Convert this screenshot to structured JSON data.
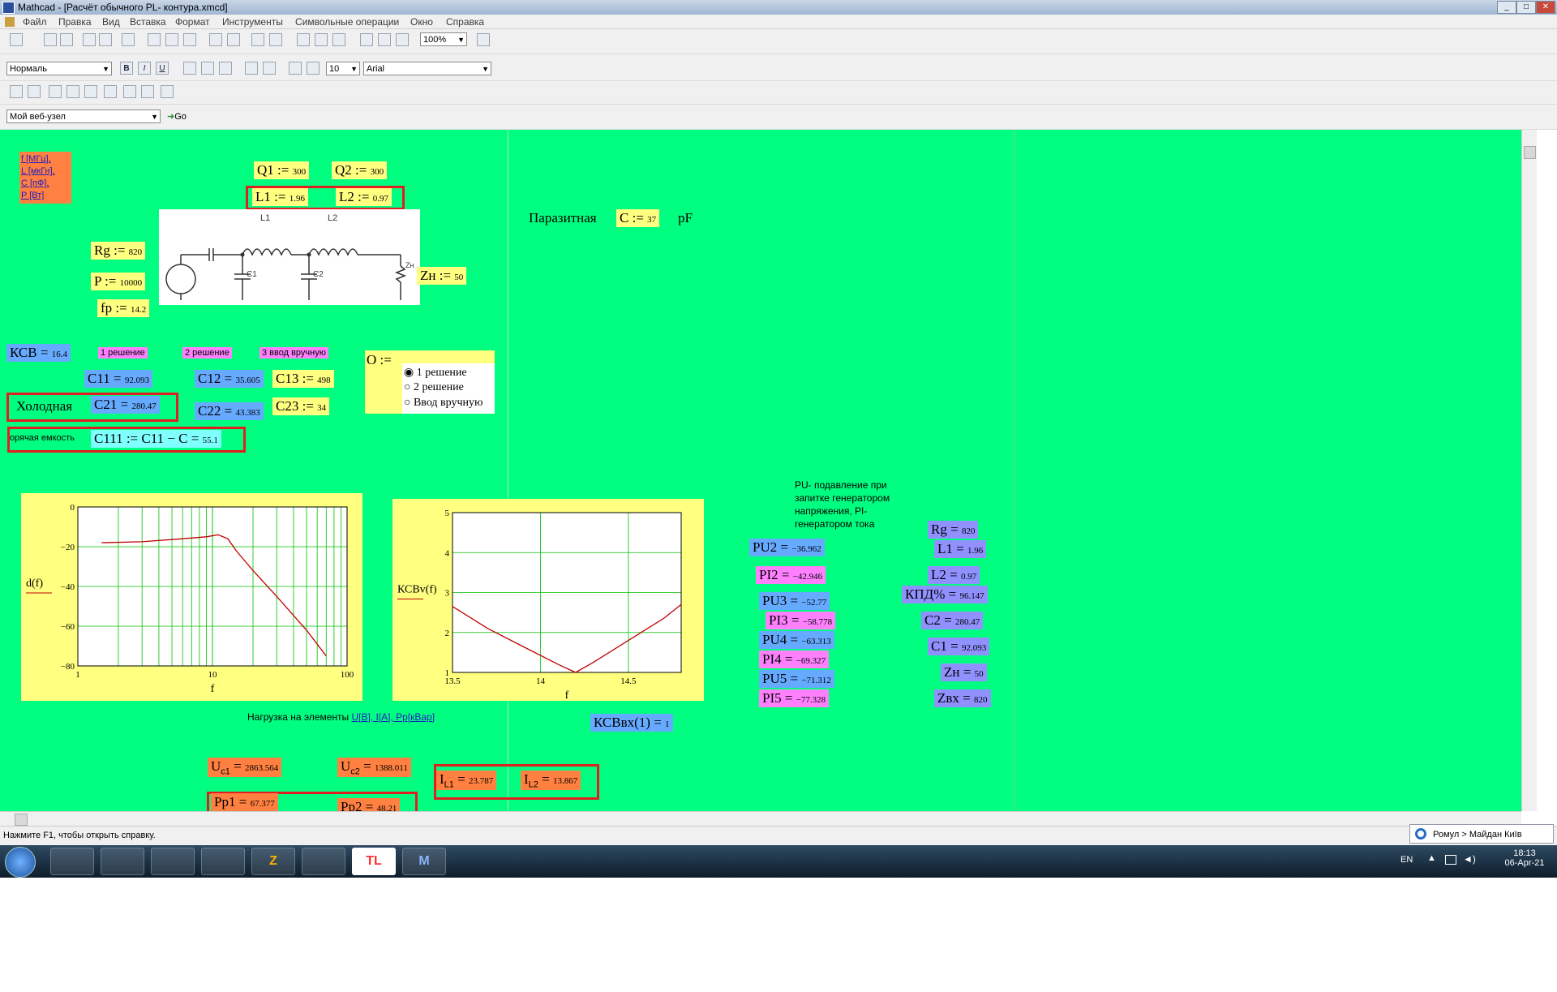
{
  "window": {
    "title": "Mathcad - [Расчёт обычного PL- контура.xmcd]",
    "min": "_",
    "max": "□",
    "close": "✕"
  },
  "menu": [
    "Файл",
    "Правка",
    "Вид",
    "Вставка",
    "Формат",
    "Инструменты",
    "Символьные операции",
    "Окно",
    "Справка"
  ],
  "toolbar": {
    "zoom": "100%",
    "style": "Нормаль",
    "font_size": "10",
    "font": "Arial",
    "bold": "B",
    "italic": "I",
    "underline": "U",
    "web_node": "Мой веб-узел",
    "go": "Go"
  },
  "sheet": {
    "units_note": [
      "f [МГц],",
      "L [мкГн],",
      "C [пФ],",
      "P [Вт]"
    ],
    "Q1": {
      "name": "Q1",
      "op": ":=",
      "val": "300"
    },
    "Q2": {
      "name": "Q2",
      "op": ":=",
      "val": "300"
    },
    "L1": {
      "name": "L1",
      "op": ":=",
      "val": "1.96"
    },
    "L2": {
      "name": "L2",
      "op": ":=",
      "val": "0.97"
    },
    "Rg": {
      "name": "Rg",
      "op": ":=",
      "val": "820"
    },
    "P": {
      "name": "P",
      "op": ":=",
      "val": "10000"
    },
    "fp": {
      "name": "fp",
      "op": ":=",
      "val": "14.2"
    },
    "Zn": {
      "name": "Zн",
      "op": ":=",
      "val": "50"
    },
    "parasitic": {
      "label": "Паразитная",
      "name": "C",
      "op": ":=",
      "val": "37",
      "unit": "pF"
    },
    "circuit": {
      "L1": "L1",
      "L2": "L2",
      "C1": "C1",
      "C2": "C2",
      "Zn": "Zн"
    },
    "KSB": {
      "name": "КСВ",
      "op": "=",
      "val": "16.4"
    },
    "sol1": "1 решение",
    "sol2": "2 решение",
    "sol3": "3 ввод вручную",
    "C11": {
      "name": "C11",
      "op": "=",
      "val": "92.093"
    },
    "C12": {
      "name": "C12",
      "op": "=",
      "val": "35.605"
    },
    "C13": {
      "name": "C13",
      "op": ":=",
      "val": "498"
    },
    "cold": "Холодная",
    "C21": {
      "name": "C21",
      "op": "=",
      "val": "280.47"
    },
    "C22": {
      "name": "C22",
      "op": "=",
      "val": "43.383"
    },
    "C23": {
      "name": "C23",
      "op": ":=",
      "val": "34"
    },
    "hot_label": "орячая емкость",
    "C111": {
      "expr": "C111 := C11 − C =",
      "val": "55.1"
    },
    "O": {
      "name": "O :=",
      "options": [
        "1 решение",
        "2 решение",
        "Ввод вручную"
      ],
      "selected": 0
    },
    "pu_note": [
      "PU- подавление при",
      "запитке генератором",
      "напряжения, PI-",
      "генератором тока"
    ],
    "results_left": [
      {
        "name": "PU2",
        "val": "−36.962",
        "color": "b"
      },
      {
        "name": "PI2",
        "val": "−42.946",
        "color": "p"
      },
      {
        "name": "PU3",
        "val": "−52.77",
        "color": "b"
      },
      {
        "name": "PI3",
        "val": "−58.778",
        "color": "p"
      },
      {
        "name": "PU4",
        "val": "−63.313",
        "color": "b"
      },
      {
        "name": "PI4",
        "val": "−69.327",
        "color": "p"
      },
      {
        "name": "PU5",
        "val": "−71.312",
        "color": "b"
      },
      {
        "name": "PI5",
        "val": "−77.328",
        "color": "p"
      }
    ],
    "results_right": [
      {
        "name": "Rg",
        "val": "820"
      },
      {
        "name": "L1",
        "val": "1.96"
      },
      {
        "name": "L2",
        "val": "0.97"
      },
      {
        "name": "КПД%",
        "val": "96.147"
      },
      {
        "name": "C2",
        "val": "280.47"
      },
      {
        "name": "C1",
        "val": "92.093"
      },
      {
        "name": "Zн",
        "val": "50"
      },
      {
        "name": "Zвх",
        "val": "820"
      }
    ],
    "load_caption_pre": "Нагрузка на элементы ",
    "load_caption_link": "U[В], I[А], Pp[кВар]",
    "KSBvx": {
      "expr": "КСВвх(1) =",
      "val": "1"
    },
    "Uc1": {
      "name": "U",
      "sub": "c1",
      "val": "2863.564"
    },
    "Uc2": {
      "name": "U",
      "sub": "c2",
      "val": "1388.011"
    },
    "IL1": {
      "name": "I",
      "sub": "L1",
      "val": "23.787"
    },
    "IL2": {
      "name": "I",
      "sub": "L2",
      "val": "13.867"
    },
    "Pp1": {
      "name": "Pp1",
      "val": "67.377"
    },
    "Pp2": {
      "name": "Pp2",
      "val": "48.21"
    }
  },
  "chart_data": [
    {
      "type": "line",
      "ylabel": "d(f)",
      "xlabel": "f",
      "xscale": "log",
      "xlim": [
        1,
        100
      ],
      "ylim": [
        -80,
        0
      ],
      "xticks": [
        "1",
        "10",
        "100"
      ],
      "yticks": [
        "0",
        "−20",
        "−40",
        "−60",
        "−80"
      ],
      "grid": true,
      "series": [
        {
          "x": [
            1.5,
            3,
            6,
            9,
            11,
            13,
            15,
            20,
            30,
            50,
            70
          ],
          "y": [
            -18,
            -17.5,
            -16,
            -15,
            -14,
            -16,
            -22,
            -32,
            -45,
            -62,
            -75
          ]
        }
      ]
    },
    {
      "type": "line",
      "ylabel": "КСВv(f)",
      "xlabel": "f",
      "xlim": [
        13.5,
        14.8
      ],
      "ylim": [
        1,
        5
      ],
      "xticks": [
        "13.5",
        "14",
        "14.5"
      ],
      "yticks": [
        "1",
        "2",
        "3",
        "4",
        "5"
      ],
      "grid": true,
      "series": [
        {
          "x": [
            13.5,
            13.7,
            13.9,
            14.1,
            14.2,
            14.3,
            14.5,
            14.7,
            14.8
          ],
          "y": [
            2.65,
            2.1,
            1.65,
            1.2,
            1.0,
            1.25,
            1.8,
            2.35,
            2.7
          ]
        }
      ]
    }
  ],
  "status": {
    "help": "Нажмите F1, чтобы открыть справку.",
    "radio": "Ромул > Майдан Київ"
  },
  "taskbar": {
    "lang": "EN",
    "time": "18:13",
    "date": "06-Apr-21",
    "apps": [
      "",
      "",
      "",
      "",
      "Z",
      "",
      "TL",
      "M"
    ]
  }
}
